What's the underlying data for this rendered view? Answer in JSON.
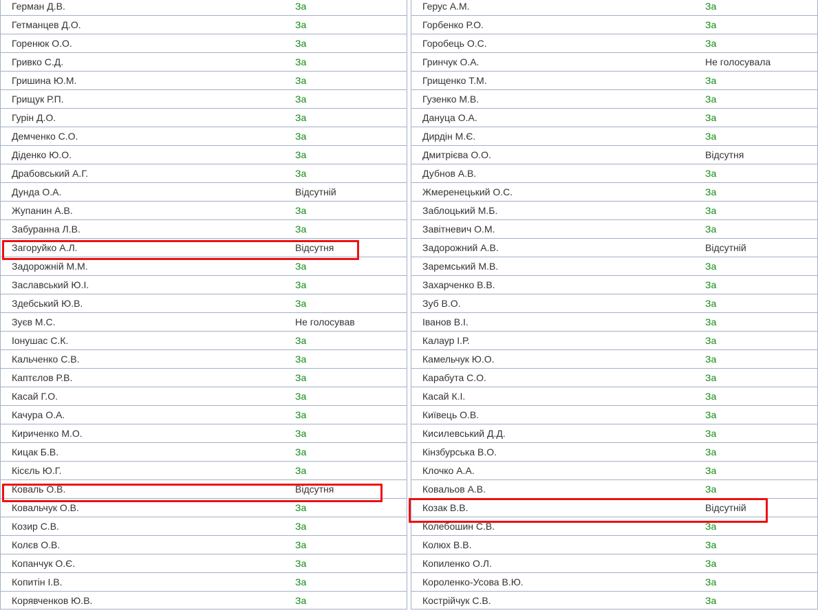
{
  "left_column": [
    {
      "name": "Герман Д.В.",
      "vote": "За"
    },
    {
      "name": "Гетманцев Д.О.",
      "vote": "За"
    },
    {
      "name": "Горенюк О.О.",
      "vote": "За"
    },
    {
      "name": "Гривко С.Д.",
      "vote": "За"
    },
    {
      "name": "Гришина Ю.М.",
      "vote": "За"
    },
    {
      "name": "Грищук Р.П.",
      "vote": "За"
    },
    {
      "name": "Гурін Д.О.",
      "vote": "За"
    },
    {
      "name": "Демченко С.О.",
      "vote": "За"
    },
    {
      "name": "Діденко Ю.О.",
      "vote": "За"
    },
    {
      "name": "Драбовський А.Г.",
      "vote": "За"
    },
    {
      "name": "Дунда О.А.",
      "vote": "Відсутній"
    },
    {
      "name": "Жупанин А.В.",
      "vote": "За"
    },
    {
      "name": "Забуранна Л.В.",
      "vote": "За"
    },
    {
      "name": "Загоруйко А.Л.",
      "vote": "Відсутня",
      "highlighted": true
    },
    {
      "name": "Задорожній М.М.",
      "vote": "За"
    },
    {
      "name": "Заславський Ю.І.",
      "vote": "За"
    },
    {
      "name": "Здебський Ю.В.",
      "vote": "За"
    },
    {
      "name": "Зуєв М.С.",
      "vote": "Не голосував"
    },
    {
      "name": "Іонушас С.К.",
      "vote": "За"
    },
    {
      "name": "Кальченко С.В.",
      "vote": "За"
    },
    {
      "name": "Каптєлов Р.В.",
      "vote": "За"
    },
    {
      "name": "Касай Г.О.",
      "vote": "За"
    },
    {
      "name": "Качура О.А.",
      "vote": "За"
    },
    {
      "name": "Кириченко М.О.",
      "vote": "За"
    },
    {
      "name": "Кицак Б.В.",
      "vote": "За"
    },
    {
      "name": "Кісєль Ю.Г.",
      "vote": "За"
    },
    {
      "name": "Коваль О.В.",
      "vote": "Відсутня",
      "highlighted": true
    },
    {
      "name": "Ковальчук О.В.",
      "vote": "За"
    },
    {
      "name": "Козир С.В.",
      "vote": "За"
    },
    {
      "name": "Колєв О.В.",
      "vote": "За"
    },
    {
      "name": "Копанчук О.Є.",
      "vote": "За"
    },
    {
      "name": "Копитін І.В.",
      "vote": "За"
    },
    {
      "name": "Корявченков Ю.В.",
      "vote": "За"
    }
  ],
  "right_column": [
    {
      "name": "Герус А.М.",
      "vote": "За"
    },
    {
      "name": "Горбенко Р.О.",
      "vote": "За"
    },
    {
      "name": "Горобець О.С.",
      "vote": "За"
    },
    {
      "name": "Гринчук О.А.",
      "vote": "Не голосувала"
    },
    {
      "name": "Грищенко Т.М.",
      "vote": "За"
    },
    {
      "name": "Гузенко М.В.",
      "vote": "За"
    },
    {
      "name": "Дануца О.А.",
      "vote": "За"
    },
    {
      "name": "Дирдін М.Є.",
      "vote": "За"
    },
    {
      "name": "Дмитрієва О.О.",
      "vote": "Відсутня"
    },
    {
      "name": "Дубнов А.В.",
      "vote": "За"
    },
    {
      "name": "Жмеренецький О.С.",
      "vote": "За"
    },
    {
      "name": "Заблоцький М.Б.",
      "vote": "За"
    },
    {
      "name": "Завітневич О.М.",
      "vote": "За"
    },
    {
      "name": "Задорожний А.В.",
      "vote": "Відсутній"
    },
    {
      "name": "Заремський М.В.",
      "vote": "За"
    },
    {
      "name": "Захарченко В.В.",
      "vote": "За"
    },
    {
      "name": "Зуб В.О.",
      "vote": "За"
    },
    {
      "name": "Іванов В.І.",
      "vote": "За"
    },
    {
      "name": "Калаур І.Р.",
      "vote": "За"
    },
    {
      "name": "Камельчук Ю.О.",
      "vote": "За"
    },
    {
      "name": "Карабута С.О.",
      "vote": "За"
    },
    {
      "name": "Касай К.І.",
      "vote": "За"
    },
    {
      "name": "Київець О.В.",
      "vote": "За"
    },
    {
      "name": "Кисилевський Д.Д.",
      "vote": "За"
    },
    {
      "name": "Кінзбурська В.О.",
      "vote": "За"
    },
    {
      "name": "Клочко А.А.",
      "vote": "За"
    },
    {
      "name": "Ковальов А.В.",
      "vote": "За"
    },
    {
      "name": "Козак В.В.",
      "vote": "Відсутній",
      "highlighted": true
    },
    {
      "name": "Колебошин С.В.",
      "vote": "За"
    },
    {
      "name": "Колюх В.В.",
      "vote": "За"
    },
    {
      "name": "Копиленко О.Л.",
      "vote": "За"
    },
    {
      "name": "Короленко-Усова В.Ю.",
      "vote": "За"
    },
    {
      "name": "Кострійчук С.В.",
      "vote": "За"
    }
  ],
  "colors": {
    "vote_for": "#108b10",
    "text": "#333333",
    "highlight": "#ee1010",
    "row_border": "#a3b0c5"
  }
}
